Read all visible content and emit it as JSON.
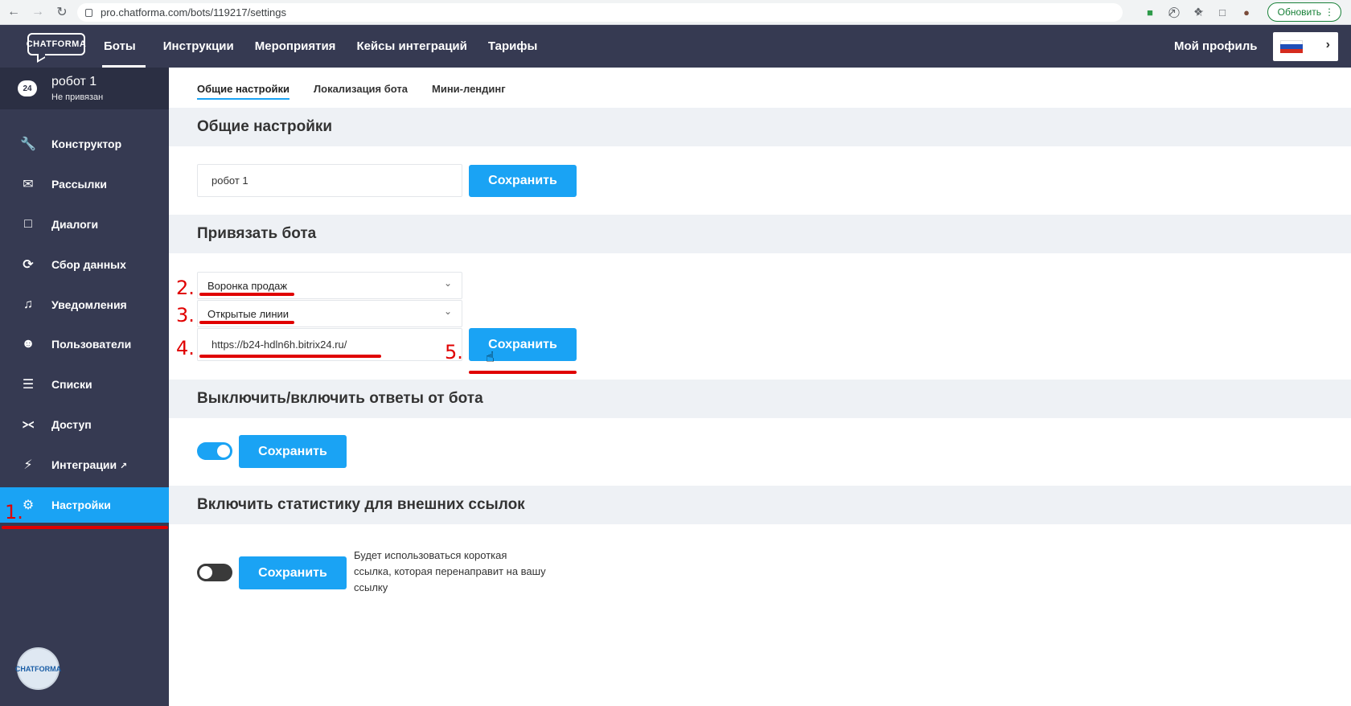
{
  "browser": {
    "url": "pro.chatforma.com/bots/119217/settings",
    "update_label": "Обновить"
  },
  "topnav": {
    "logo": "CHATFORMA",
    "menu": [
      "Боты",
      "Инструкции",
      "Мероприятия",
      "Кейсы интеграций",
      "Тарифы"
    ],
    "profile": "Мой профиль"
  },
  "bot": {
    "name": "робот 1",
    "status": "Не привязан"
  },
  "sidebar": {
    "items": [
      {
        "label": "Конструктор",
        "icon": "wrench-icon"
      },
      {
        "label": "Рассылки",
        "icon": "envelope-icon"
      },
      {
        "label": "Диалоги",
        "icon": "chat-icon"
      },
      {
        "label": "Сбор данных",
        "icon": "circle-arrow-icon"
      },
      {
        "label": "Уведомления",
        "icon": "bell-icon"
      },
      {
        "label": "Пользователи",
        "icon": "users-icon"
      },
      {
        "label": "Списки",
        "icon": "list-icon"
      },
      {
        "label": "Доступ",
        "icon": "share-icon"
      },
      {
        "label": "Интеграции",
        "icon": "plug-icon"
      },
      {
        "label": "Настройки",
        "icon": "gear-icon"
      }
    ],
    "avatar_text": "CHATFORMA"
  },
  "tabs": [
    "Общие настройки",
    "Локализация бота",
    "Мини-лендинг"
  ],
  "sections": {
    "general": {
      "title": "Общие настройки",
      "name_value": "робот 1",
      "save": "Сохранить"
    },
    "bind": {
      "title": "Привязать бота",
      "select1": "Воронка продаж",
      "select2": "Открытые линии",
      "url_value": "https://b24-hdln6h.bitrix24.ru/",
      "save": "Сохранить"
    },
    "toggle_answers": {
      "title": "Выключить/включить ответы от бота",
      "enabled": true,
      "save": "Сохранить"
    },
    "stats": {
      "title": "Включить статистику для внешних ссылок",
      "enabled": false,
      "save": "Сохранить",
      "note": "Будет использоваться короткая ссылка, которая перенаправит на вашу ссылку"
    }
  },
  "annotations": [
    "1.",
    "2.",
    "3.",
    "4.",
    "5."
  ],
  "colors": {
    "nav_bg": "#363a52",
    "accent": "#1aa3f4",
    "annotation": "#e00000"
  }
}
